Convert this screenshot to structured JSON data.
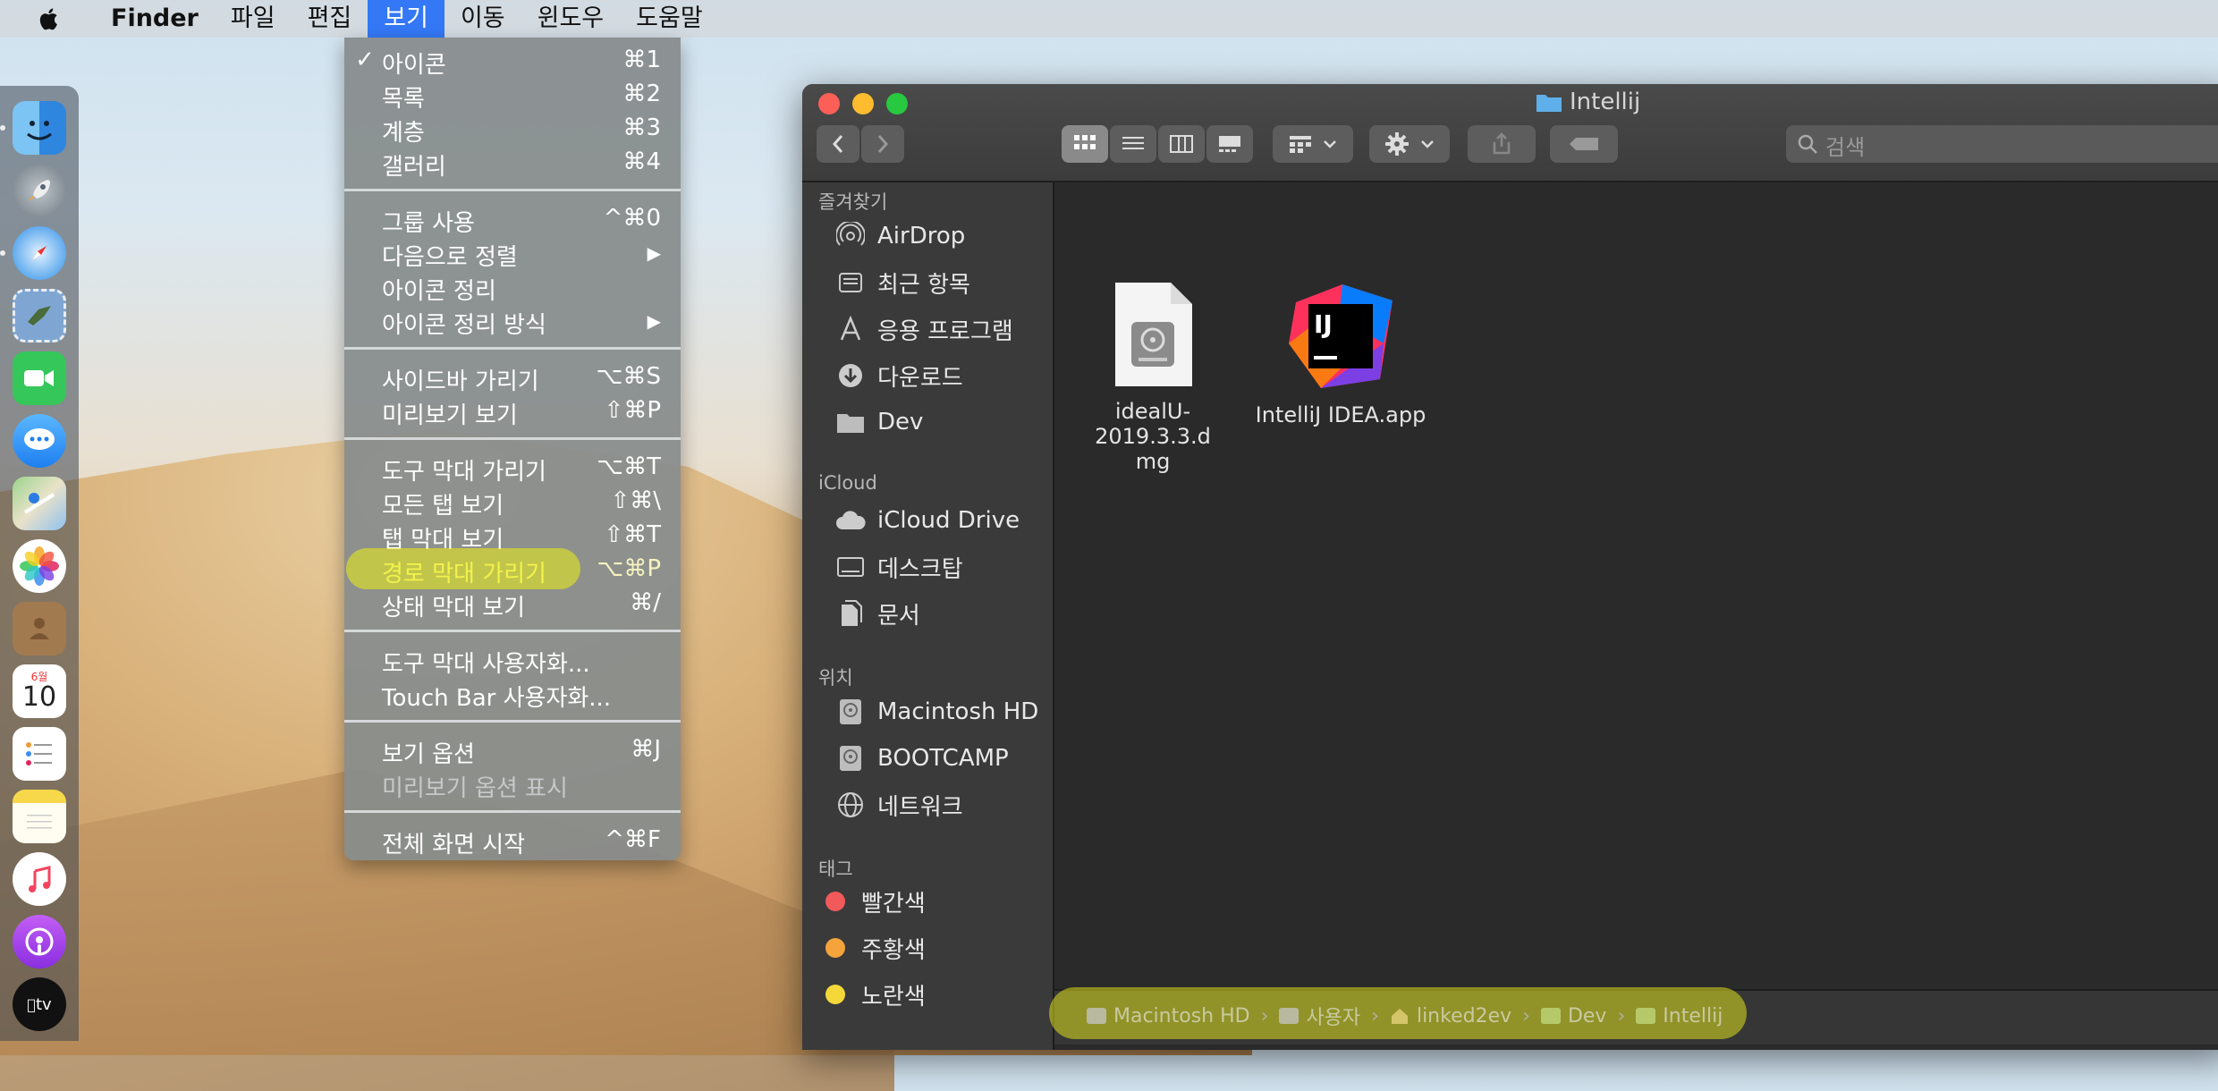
{
  "menubar": {
    "app_name": "Finder",
    "menus": [
      "파일",
      "편집",
      "보기",
      "이동",
      "윈도우",
      "도움말"
    ],
    "active_menu": "보기"
  },
  "view_menu": {
    "items": [
      {
        "check": "✓",
        "label": "아이콘",
        "shortcut": "⌘1"
      },
      {
        "label": "목록",
        "shortcut": "⌘2"
      },
      {
        "label": "계층",
        "shortcut": "⌘3"
      },
      {
        "label": "갤러리",
        "shortcut": "⌘4"
      },
      {
        "label": "그룹 사용",
        "shortcut": "^⌘0"
      },
      {
        "label": "다음으로 정렬",
        "shortcut": "▶"
      },
      {
        "label": "아이콘 정리",
        "shortcut": ""
      },
      {
        "label": "아이콘 정리 방식",
        "shortcut": "▶"
      },
      {
        "label": "사이드바 가리기",
        "shortcut": "⌥⌘S"
      },
      {
        "label": "미리보기 보기",
        "shortcut": "⇧⌘P"
      },
      {
        "label": "도구 막대 가리기",
        "shortcut": "⌥⌘T"
      },
      {
        "label": "모든 탭 보기",
        "shortcut": "⇧⌘\\"
      },
      {
        "label": "탭 막대 보기",
        "shortcut": "⇧⌘T"
      },
      {
        "label": "경로 막대 가리기",
        "shortcut": "⌥⌘P"
      },
      {
        "label": "상태 막대 보기",
        "shortcut": "⌘/"
      },
      {
        "label": "도구 막대 사용자화...",
        "shortcut": ""
      },
      {
        "label": "Touch Bar 사용자화...",
        "shortcut": ""
      },
      {
        "label": "보기 옵션",
        "shortcut": "⌘J"
      },
      {
        "label": "미리보기 옵션 표시",
        "shortcut": ""
      },
      {
        "label": "전체 화면 시작",
        "shortcut": "^⌘F"
      }
    ]
  },
  "dock": {
    "calendar_month": "6월",
    "calendar_day": "10",
    "tv_label": "tv"
  },
  "window": {
    "title": "Intellij",
    "search_placeholder": "검색",
    "sidebar": {
      "favorites_header": "즐겨찾기",
      "favorites": [
        "AirDrop",
        "최근 항목",
        "응용 프로그램",
        "다운로드",
        "Dev"
      ],
      "icloud_header": "iCloud",
      "icloud": [
        "iCloud Drive",
        "데스크탑",
        "문서"
      ],
      "locations_header": "위치",
      "locations": [
        "Macintosh HD",
        "BOOTCAMP",
        "네트워크"
      ],
      "tags_header": "태그",
      "tags": [
        {
          "label": "빨간색",
          "color": "#f05a5a"
        },
        {
          "label": "주황색",
          "color": "#f5a33b"
        },
        {
          "label": "노란색",
          "color": "#f4d83a"
        }
      ]
    },
    "files": [
      {
        "name_line1": "idealU-2019.3.3.d",
        "name_line2": "mg"
      },
      {
        "name_line1": "IntelliJ IDEA.app",
        "name_line2": ""
      }
    ],
    "pathbar": [
      "Macintosh HD",
      "사용자",
      "linked2ev",
      "Dev",
      "Intellij"
    ]
  },
  "colors": {
    "menu_highlight": "#f3f24d",
    "accent": "#3478f6"
  }
}
